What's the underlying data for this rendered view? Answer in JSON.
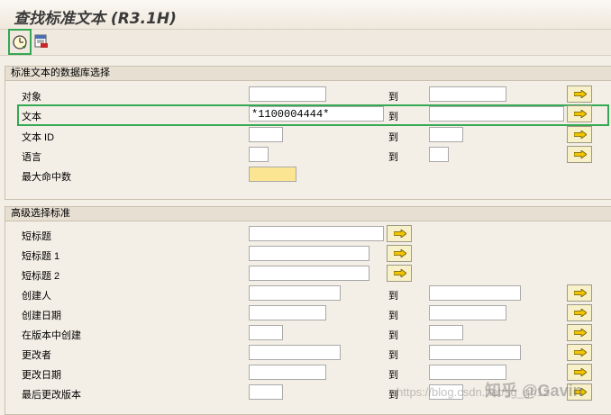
{
  "title": "查找标准文本 (R3.1H)",
  "toolbar": {
    "execute_icon": "execute-icon",
    "print_icon": "print-icon"
  },
  "group1": {
    "title": "标准文本的数据库选择",
    "rows": [
      {
        "label": "对象",
        "from": "",
        "to_label": "到",
        "to": ""
      },
      {
        "label": "文本",
        "from": "*1100004444*",
        "to_label": "到",
        "to": ""
      },
      {
        "label": "文本 ID",
        "from": "",
        "to_label": "到",
        "to": ""
      },
      {
        "label": "语言",
        "from": "",
        "to_label": "到",
        "to": ""
      },
      {
        "label": "最大命中数",
        "from": ""
      }
    ]
  },
  "group2": {
    "title": "高级选择标准",
    "rows": [
      {
        "label": "短标题",
        "from": ""
      },
      {
        "label": "短标题 1",
        "from": ""
      },
      {
        "label": "短标题 2",
        "from": ""
      },
      {
        "label": "创建人",
        "from": "",
        "to_label": "到",
        "to": ""
      },
      {
        "label": "创建日期",
        "from": "",
        "to_label": "到",
        "to": ""
      },
      {
        "label": "在版本中创建",
        "from": "",
        "to_label": "到",
        "to": ""
      },
      {
        "label": "更改者",
        "from": "",
        "to_label": "到",
        "to": ""
      },
      {
        "label": "更改日期",
        "from": "",
        "to_label": "到",
        "to": ""
      },
      {
        "label": "最后更改版本",
        "from": "",
        "to_label": "到",
        "to": ""
      }
    ]
  },
  "watermark": {
    "text1": "https://blog.csdn.net/sg_gh12",
    "text2": "知乎 @Gavin"
  }
}
